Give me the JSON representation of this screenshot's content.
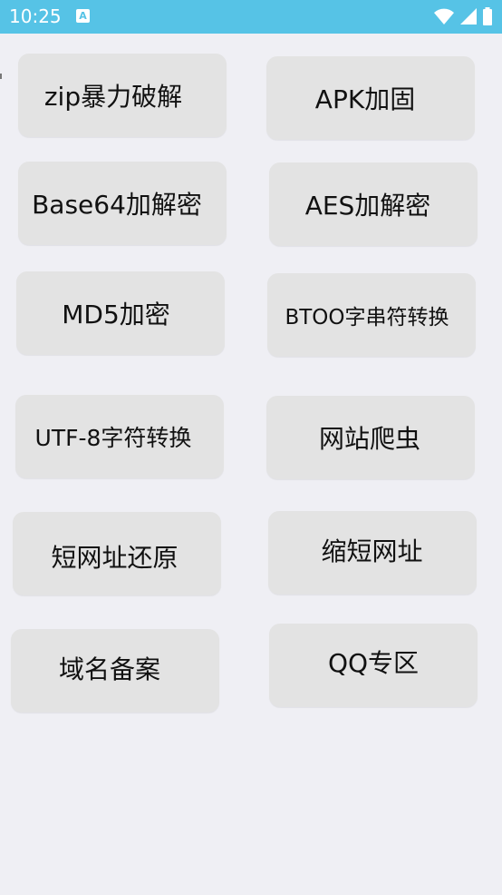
{
  "status_bar": {
    "time": "10:25",
    "notification_icon_label": "A",
    "icons": [
      "wifi-icon",
      "signal-icon",
      "battery-icon"
    ]
  },
  "buttons": [
    {
      "id": "zip-crack",
      "label": "zip暴力破解"
    },
    {
      "id": "apk-harden",
      "label": "APK加固"
    },
    {
      "id": "base64",
      "label": "Base64加解密"
    },
    {
      "id": "aes",
      "label": "AES加解密"
    },
    {
      "id": "md5",
      "label": "MD5加密"
    },
    {
      "id": "btoo",
      "label": "BTOO字串符转换"
    },
    {
      "id": "utf8",
      "label": "UTF-8字符转换"
    },
    {
      "id": "crawler",
      "label": "网站爬虫"
    },
    {
      "id": "restore-short-url",
      "label": "短网址还原"
    },
    {
      "id": "shorten-url",
      "label": "缩短网址"
    },
    {
      "id": "domain-icp",
      "label": "域名备案"
    },
    {
      "id": "qq-zone",
      "label": "QQ专区"
    }
  ],
  "colors": {
    "status_bar": "#56c3e6",
    "background": "#efeff4",
    "button": "#e3e3e3",
    "text": "#111111"
  }
}
